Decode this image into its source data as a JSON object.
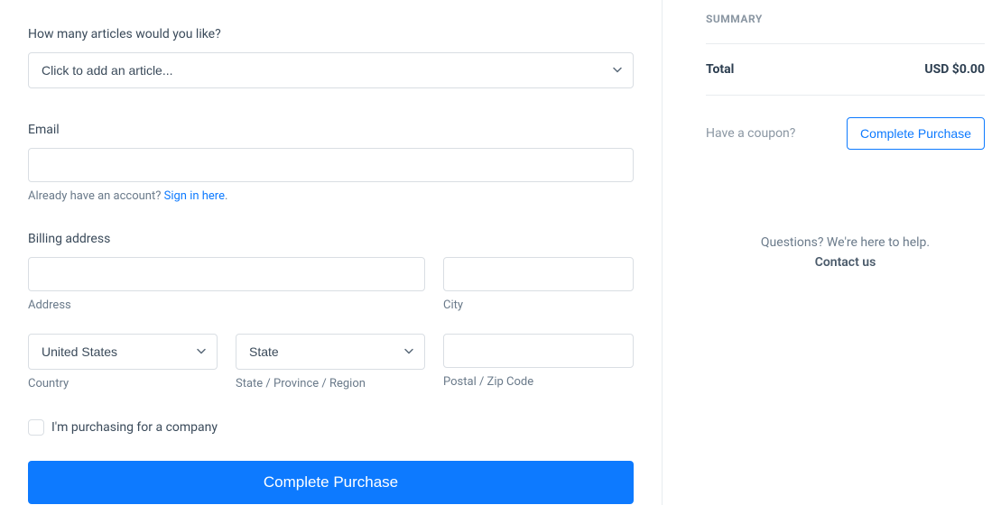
{
  "form": {
    "articles": {
      "label": "How many articles would you like?",
      "placeholder": "Click to add an article..."
    },
    "email": {
      "label": "Email",
      "value": "",
      "helper_prefix": "Already have an account? ",
      "helper_link": "Sign in here",
      "helper_suffix": "."
    },
    "billing": {
      "label": "Billing address",
      "address": {
        "value": "",
        "sublabel": "Address"
      },
      "city": {
        "value": "",
        "sublabel": "City"
      },
      "country": {
        "value": "United States",
        "sublabel": "Country"
      },
      "state": {
        "value": "State",
        "sublabel": "State / Province / Region"
      },
      "postal": {
        "value": "",
        "sublabel": "Postal / Zip Code"
      }
    },
    "company_checkbox": {
      "label": "I'm purchasing for a company",
      "checked": false
    },
    "submit_label": "Complete Purchase"
  },
  "summary": {
    "title": "SUMMARY",
    "total_label": "Total",
    "total_value": "USD $0.00",
    "coupon_text": "Have a coupon?",
    "complete_label": "Complete Purchase"
  },
  "help": {
    "question": "Questions? We're here to help.",
    "contact": "Contact us"
  }
}
